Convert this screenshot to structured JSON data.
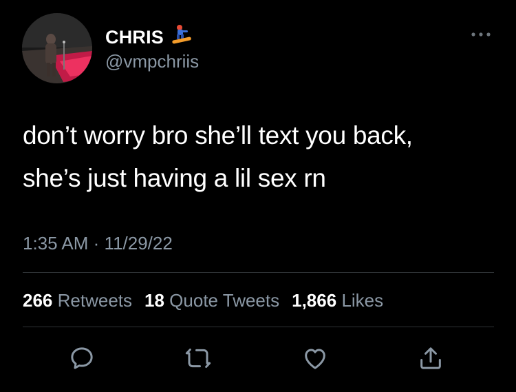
{
  "author": {
    "display_name": "CHRIS",
    "handle": "@vmpchriis",
    "name_emoji": "snowboarder-emoji",
    "avatar": "profile-photo"
  },
  "tweet": {
    "lines": [
      "don’t worry bro she’ll text you back,",
      "she’s just having a lil sex rn"
    ],
    "time": "1:35 AM",
    "separator": "·",
    "date": "11/29/22"
  },
  "stats": {
    "retweets_count": "266",
    "retweets_label": "Retweets",
    "quotes_count": "18",
    "quotes_label": "Quote Tweets",
    "likes_count": "1,866",
    "likes_label": "Likes"
  },
  "actions": [
    "reply-icon",
    "retweet-icon",
    "like-icon",
    "share-icon"
  ],
  "colors": {
    "background": "#000000",
    "text": "#ffffff",
    "secondary": "#8b98a5",
    "divider": "#2f3336"
  }
}
